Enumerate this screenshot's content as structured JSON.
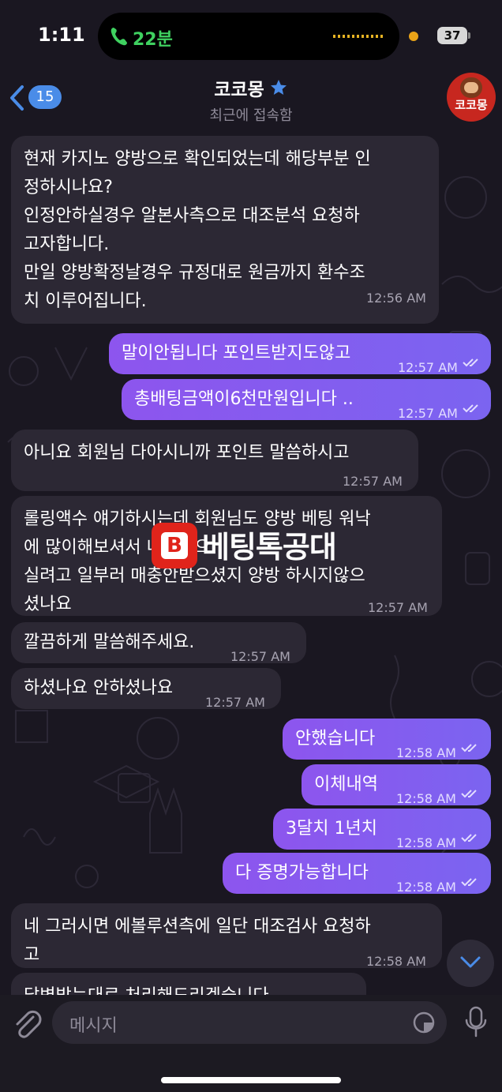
{
  "status_bar": {
    "time": "1:11",
    "call_duration": "22분",
    "battery": "37"
  },
  "header": {
    "back_count": "15",
    "title": "코코몽",
    "subtitle": "최근에 접속함",
    "avatar_text": "코코몽"
  },
  "messages": [
    {
      "direction": "in",
      "lines": [
        "현재 카지노 양방으로 확인되었는데 해당부분 인",
        "정하시나요?",
        "인정안하실경우 알본사측으로 대조분석 요청하",
        "고자합니다.",
        "만일 양방확정날경우 규정대로 원금까지 환수조",
        "치 이루어집니다."
      ],
      "time": "12:56 AM"
    },
    {
      "direction": "out",
      "lines": [
        "말이안됩니다 포인트받지도않고"
      ],
      "time": "12:57 AM"
    },
    {
      "direction": "out",
      "lines": [
        "총배팅금액이6천만원입니다 .."
      ],
      "time": "12:57 AM"
    },
    {
      "direction": "in",
      "lines": [
        "아니요 회원님 다아시니까 포인트 말씀하시고"
      ],
      "time": "12:57 AM"
    },
    {
      "direction": "in",
      "lines": [
        "롤링액수 얘기하시는데 회원님도 양방 베팅 워낙",
        "에 많이해보셔서 내역쌓으",
        "실려고 일부러 매충안받으셨지 양방 하시지않으",
        "셨나요"
      ],
      "time": "12:57 AM"
    },
    {
      "direction": "in",
      "lines": [
        "깔끔하게 말씀해주세요."
      ],
      "time": "12:57 AM"
    },
    {
      "direction": "in",
      "lines": [
        "하셨나요 안하셨나요"
      ],
      "time": "12:57 AM"
    },
    {
      "direction": "out",
      "lines": [
        "안했습니다"
      ],
      "time": "12:58 AM"
    },
    {
      "direction": "out",
      "lines": [
        "이체내역"
      ],
      "time": "12:58 AM"
    },
    {
      "direction": "out",
      "lines": [
        "3달치 1년치"
      ],
      "time": "12:58 AM"
    },
    {
      "direction": "out",
      "lines": [
        "다 증명가능합니다"
      ],
      "time": "12:58 AM"
    },
    {
      "direction": "in",
      "lines": [
        "네 그러시면 에볼루션측에 일단 대조검사 요청하",
        "고"
      ],
      "time": "12:58 AM"
    },
    {
      "direction": "in",
      "lines": [
        "답변받는대로 처리해드리겠습니다"
      ],
      "time": ""
    }
  ],
  "watermark": {
    "text": "베팅톡공대",
    "logo_letter": "B"
  },
  "input": {
    "placeholder": "메시지"
  },
  "colors": {
    "outgoing_bubble": "#8a5af0",
    "incoming_bubble": "#2c2834",
    "background": "#1a1721",
    "accent_blue": "#4a8ce8",
    "call_green": "#3fd160"
  },
  "icons": [
    "phone-icon",
    "back-chevron-icon",
    "star-icon",
    "read-check-icon",
    "scroll-down-icon",
    "attach-icon",
    "sticker-icon",
    "microphone-icon"
  ]
}
